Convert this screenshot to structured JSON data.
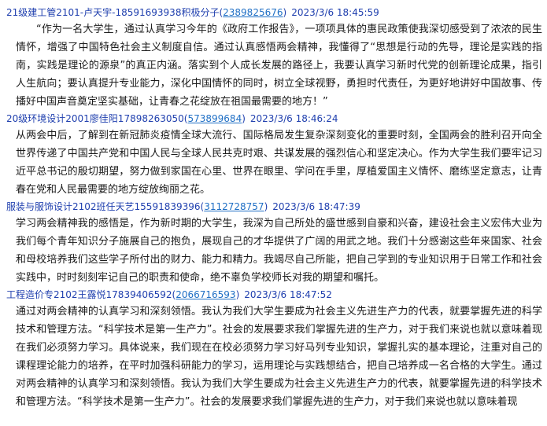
{
  "messages": [
    {
      "sender": "21级建工管2101-卢天宇-18591693938积极分子",
      "qq": "2389825676",
      "time": "2023/3/6 18:45:59",
      "text": "“作为一名大学生，通过认真学习今年的《政府工作报告》，一项项具体的惠民政策使我深切感受到了浓浓的民生情怀，增强了中国特色社会主义制度自信。通过认真感悟两会精神，我懂得了“思想是行动的先导，理论是实践的指南，实践是理论的源泉”的真正内涵。落实到个人成长发展的路径上，我要认真学习新时代党的创新理论成果，指引人生航向；要认真提升专业能力，深化中国情怀的同时，树立全球视野，勇担时代责任，为更好地讲好中国故事、传播好中国声音奠定坚实基础，让青春之花绽放在祖国最需要的地方！”"
    },
    {
      "sender": "20级环境设计2001廖佳阳17898263050",
      "qq": "573899684",
      "time": "2023/3/6 18:46:24",
      "text": "从两会中后，了解到在新冠肺炎疫情全球大流行、国际格局发生复杂深刻变化的重要时刻，全国两会的胜利召开向全世界传递了中国共产党和中国人民与全球人民共克时艰、共谋发展的强烈信心和坚定决心。作为大学生我们要牢记习近平总书记的殷切期望，努力做到家国在心里、世界在眼里、学问在手里，厚植爱国主义情怀、磨练坚定意志，让青春在党和人民最需要的地方绽放绚丽之花。"
    },
    {
      "sender": "服装与服饰设计2102班任天艺15591839396",
      "qq": "3112728757",
      "time": "2023/3/6 18:47:39",
      "text": "学习两会精神我的感悟是，作为新时期的大学生，我深为自己所处的盛世感到自豪和兴奋，建设社会主义宏伟大业为我们每个青年知识分子施展自己的抱负，展现自己的才华提供了广阔的用武之地。我们十分感谢这些年来国家、社会和母校培养我们这些学子所付出的财力、能力和精力。我竭尽自己所能，把自己学到的专业知识用于日常工作和社会实践中，时时刻刻牢记自己的职责和使命，绝不辜负学校师长对我的期望和嘱托。"
    },
    {
      "sender": "工程造价专2102王露悦17839406592",
      "qq": "2066716593",
      "time": "2023/3/6 18:47:52",
      "text": "通过对两会精神的认真学习和深刻领悟。我认为我们大学生要成为社会主义先进生产力的代表，就要掌握先进的科学技术和管理方法。“科学技术是第一生产力”。社会的发展要求我们掌握先进的生产力，对于我们来说也就以意味着现在我们必须努力学习。具体说来，我们现在在校必须努力学习好马列专业知识，掌握扎实的基本理论，注重对自己的课程理论能力的培养，在平时加强科研能力的学习，运用理论与实践想结合，把自己培养成一名合格的大学生。通过对两会精神的认真学习和深刻领悟。我认为我们大学生要成为社会主义先进生产力的代表，就要掌握先进的科学技术和管理方法。“科学技术是第一生产力”。社会的发展要求我们掌握先进的生产力，对于我们来说也就以意味着现"
    }
  ]
}
